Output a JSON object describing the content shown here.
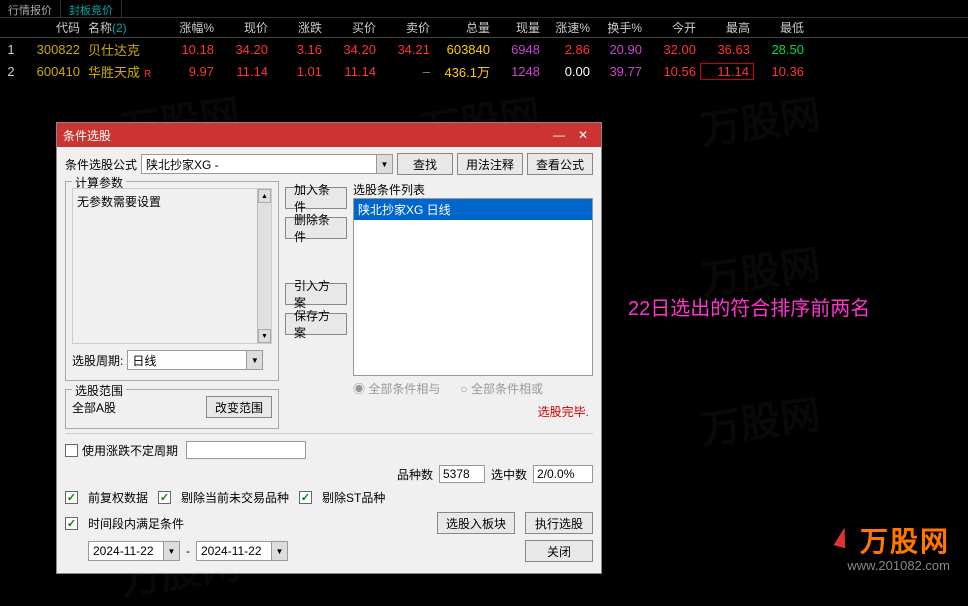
{
  "tabs": {
    "quote": "行情报价",
    "limit": "封板竞价"
  },
  "headers": {
    "code": "代码",
    "name": "名称",
    "name_count": "(2)",
    "pct": "涨幅%",
    "now": "现价",
    "chg": "涨跌",
    "bid": "买价",
    "ask": "卖价",
    "vol": "总量",
    "cvol": "现量",
    "spd": "涨速%",
    "turn": "换手%",
    "open": "今开",
    "high": "最高",
    "low": "最低"
  },
  "rows": [
    {
      "idx": "1",
      "code": "300822",
      "name": "贝仕达克",
      "tag": "",
      "pct": "10.18",
      "now": "34.20",
      "chg": "3.16",
      "bid": "34.20",
      "ask": "34.21",
      "vol": "603840",
      "cvol": "6948",
      "spd": "2.86",
      "turn": "20.90",
      "open": "32.00",
      "high": "36.63",
      "low": "28.50",
      "colors": {
        "pct": "c-red",
        "now": "c-red",
        "chg": "c-red",
        "bid": "c-red",
        "ask": "c-red",
        "vol": "c-yellow",
        "cvol": "c-purple",
        "spd": "c-red",
        "turn": "c-purple",
        "open": "c-red",
        "high": "c-red",
        "low": "c-green"
      }
    },
    {
      "idx": "2",
      "code": "600410",
      "name": "华胜天成",
      "tag": "R",
      "pct": "9.97",
      "now": "11.14",
      "chg": "1.01",
      "bid": "11.14",
      "ask": "–",
      "vol": "436.1万",
      "cvol": "1248",
      "spd": "0.00",
      "turn": "39.77",
      "open": "10.56",
      "high": "11.14",
      "low": "10.36",
      "colors": {
        "pct": "c-red",
        "now": "c-red",
        "chg": "c-red",
        "bid": "c-red",
        "ask": "c-gray",
        "vol": "c-yellow",
        "cvol": "c-purple",
        "spd": "c-white",
        "turn": "c-purple",
        "open": "c-red",
        "high": "c-red",
        "low": "c-red"
      },
      "high_border": true
    }
  ],
  "annotation": "22日选出的符合排序前两名",
  "dialog": {
    "title": "条件选股",
    "formula_label": "条件选股公式",
    "formula_value": "陕北抄家XG  -",
    "btn_find": "查找",
    "btn_usage": "用法注释",
    "btn_viewfx": "查看公式",
    "params_legend": "计算参数",
    "params_text": "无参数需要设置",
    "btn_add": "加入条件",
    "btn_del": "删除条件",
    "btn_import": "引入方案",
    "btn_save": "保存方案",
    "period_label": "选股周期:",
    "period_value": "日线",
    "range_legend": "选股范围",
    "range_value": "全部A股",
    "btn_range": "改变范围",
    "list_legend": "选股条件列表",
    "list_item": "陕北抄家XG  日线",
    "radio_and": "全部条件相与",
    "radio_or": "全部条件相或",
    "status": "选股完毕.",
    "chk_vary": "使用涨跌不定周期",
    "count_label": "品种数",
    "count_val": "5378",
    "selected_label": "选中数",
    "selected_val": "2/0.0%",
    "chk_fq": "前复权数据",
    "chk_exclude_nontrade": "剔除当前未交易品种",
    "chk_exclude_st": "剔除ST品种",
    "chk_timerange": "时间段内满足条件",
    "btn_toblock": "选股入板块",
    "btn_exec": "执行选股",
    "date_from": "2024-11-22",
    "date_to": "2024-11-22",
    "date_sep": "-",
    "btn_close": "关闭"
  },
  "watermark": {
    "brand": "万股网",
    "url": "www.201082.com",
    "ghost": "万股网"
  }
}
